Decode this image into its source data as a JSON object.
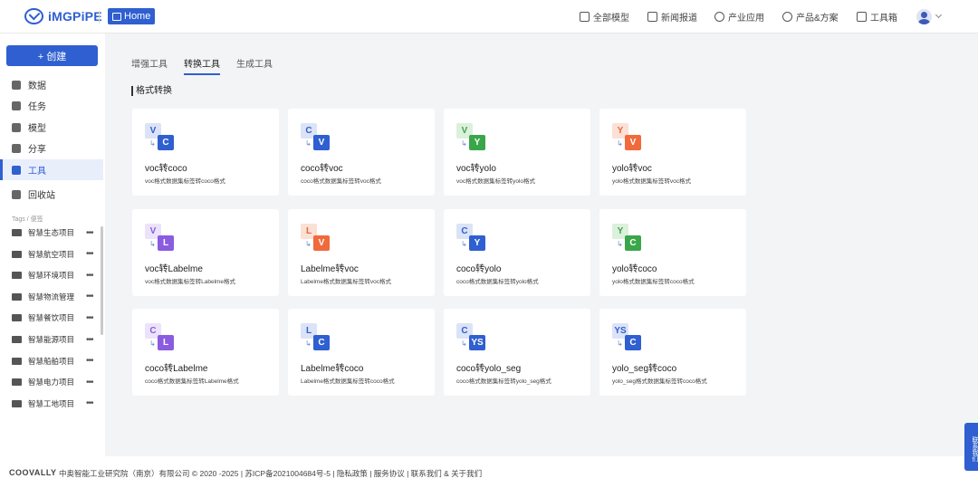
{
  "header": {
    "logo": "iMGPiPE",
    "home": "Home",
    "nav": [
      "全部模型",
      "新闻报道",
      "产业应用",
      "产品&方案",
      "工具箱"
    ]
  },
  "sidebar": {
    "create": "+ 创建",
    "items": [
      "数据",
      "任务",
      "模型",
      "分享",
      "工具",
      "回收站"
    ],
    "active_item": "工具",
    "tags_label": "Tags / 便签",
    "projects": [
      "智慧生态项目",
      "智慧航空项目",
      "智慧环境项目",
      "智慧物流管理",
      "智慧餐饮项目",
      "智慧能源项目",
      "智慧船舶项目",
      "智慧电力项目",
      "智慧工地项目"
    ],
    "more": "•••"
  },
  "tabs": [
    "增强工具",
    "转换工具",
    "生成工具"
  ],
  "active_tab": "转换工具",
  "section_title": "格式转换",
  "cards": [
    {
      "from": "V",
      "to": "C",
      "title": "voc转coco",
      "desc": "voc格式数据集标签转coco格式",
      "fc": "#dbe3f7",
      "ft": "#2f5fd0",
      "tc": "#2f5fd0"
    },
    {
      "from": "C",
      "to": "V",
      "title": "coco转voc",
      "desc": "coco格式数据集标签转voc格式",
      "fc": "#dbe3f7",
      "ft": "#2f5fd0",
      "tc": "#2f5fd0"
    },
    {
      "from": "V",
      "to": "Y",
      "title": "voc转yolo",
      "desc": "voc格式数据集标签转yolo格式",
      "fc": "#dcf0dc",
      "ft": "#3aa64a",
      "tc": "#3aa64a"
    },
    {
      "from": "Y",
      "to": "V",
      "title": "yolo转voc",
      "desc": "yolo格式数据集标签转voc格式",
      "fc": "#fbe0d5",
      "ft": "#e8673d",
      "tc": "#f06a3c"
    },
    {
      "from": "V",
      "to": "L",
      "title": "voc转Labelme",
      "desc": "voc格式数据集标签转Labelme格式",
      "fc": "#ebe3fa",
      "ft": "#8a5ce0",
      "tc": "#8a5ce0"
    },
    {
      "from": "L",
      "to": "V",
      "title": "Labelme转voc",
      "desc": "Labelme格式数据集标签转voc格式",
      "fc": "#fbe0d5",
      "ft": "#e8673d",
      "tc": "#f06a3c"
    },
    {
      "from": "C",
      "to": "Y",
      "title": "coco转yolo",
      "desc": "coco格式数据集标签转yolo格式",
      "fc": "#dbe3f7",
      "ft": "#2f5fd0",
      "tc": "#2f5fd0"
    },
    {
      "from": "Y",
      "to": "C",
      "title": "yolo转coco",
      "desc": "yolo格式数据集标签转coco格式",
      "fc": "#dcf0dc",
      "ft": "#3aa64a",
      "tc": "#3aa64a"
    },
    {
      "from": "C",
      "to": "L",
      "title": "coco转Labelme",
      "desc": "coco格式数据集标签转Labelme格式",
      "fc": "#ebe3fa",
      "ft": "#8a5ce0",
      "tc": "#8a5ce0"
    },
    {
      "from": "L",
      "to": "C",
      "title": "Labelme转coco",
      "desc": "Labelme格式数据集标签转coco格式",
      "fc": "#dbe3f7",
      "ft": "#2f5fd0",
      "tc": "#2f5fd0"
    },
    {
      "from": "C",
      "to": "YS",
      "title": "coco转yolo_seg",
      "desc": "coco格式数据集标签转yolo_seg格式",
      "fc": "#dbe3f7",
      "ft": "#2f5fd0",
      "tc": "#2f5fd0"
    },
    {
      "from": "YS",
      "to": "C",
      "title": "yolo_seg转coco",
      "desc": "yolo_seg格式数据集标签转coco格式",
      "fc": "#dbe3f7",
      "ft": "#2f5fd0",
      "tc": "#2f5fd0"
    }
  ],
  "footer": {
    "brand": "COOVALLY",
    "text": "中奥智能工业研究院（南京）有限公司 © 2020 -2025 | 苏ICP备2021004684号-5 | 隐私政策 | 服务协议 | 联系我们 & 关于我们"
  },
  "float_contact": "联系我们"
}
